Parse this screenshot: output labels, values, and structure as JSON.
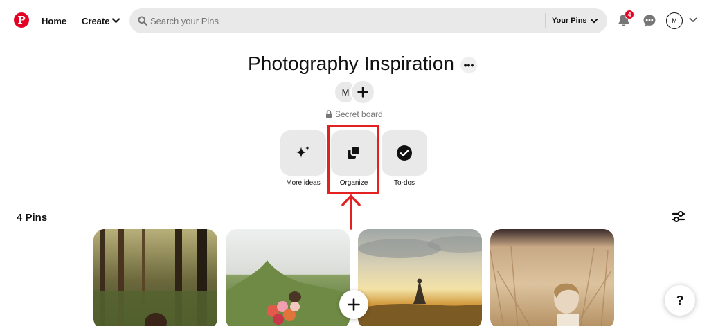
{
  "header": {
    "logo_letter": "P",
    "home_label": "Home",
    "create_label": "Create",
    "search_placeholder": "Search your Pins",
    "search_value": "",
    "scope_label": "Your Pins",
    "notifications_count": "4",
    "avatar_initial": "M"
  },
  "board": {
    "title": "Photography Inspiration",
    "more_label": "•••",
    "owner_initial": "M",
    "privacy_label": "Secret board",
    "actions": [
      {
        "label": "More ideas",
        "icon": "sparkle-icon"
      },
      {
        "label": "Organize",
        "icon": "organize-icon"
      },
      {
        "label": "To-dos",
        "icon": "check-circle-icon"
      }
    ],
    "highlight_color": "#e32121"
  },
  "pins": {
    "count_label": "4 Pins",
    "items": [
      {
        "scene": "forest-walk"
      },
      {
        "scene": "flower-bouquet-field"
      },
      {
        "scene": "sunset-meadow-dancer"
      },
      {
        "scene": "woman-in-wheat-field"
      }
    ]
  },
  "help_label": "?",
  "colors": {
    "brand": "#e60023",
    "tile_bg": "#e9e9e9",
    "text": "#111111",
    "muted": "#767676"
  }
}
